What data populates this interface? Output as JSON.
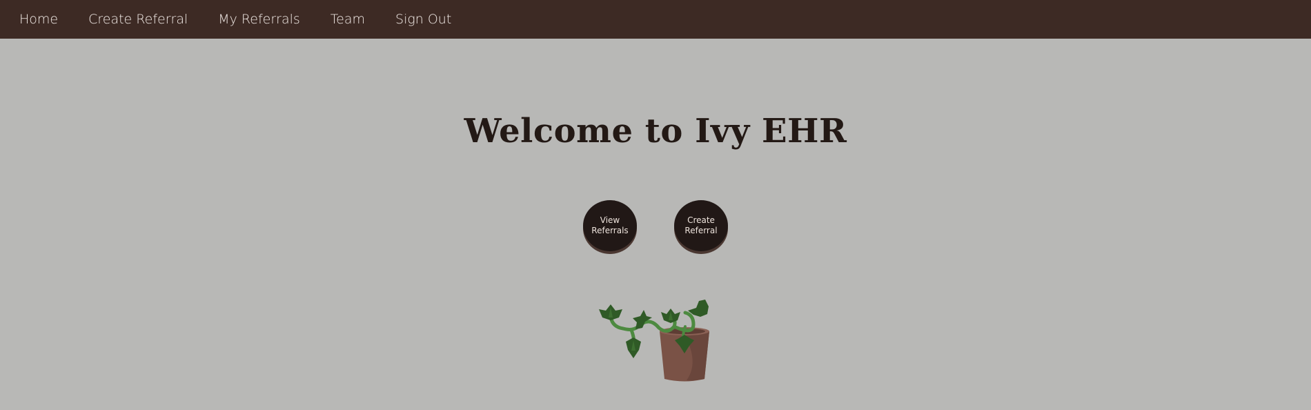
{
  "nav": {
    "items": [
      {
        "label": "Home"
      },
      {
        "label": "Create Referral"
      },
      {
        "label": "My Referrals"
      },
      {
        "label": "Team"
      },
      {
        "label": "Sign Out"
      }
    ]
  },
  "main": {
    "title": "Welcome to Ivy EHR",
    "buttons": {
      "view_referrals": {
        "line1": "View",
        "line2": "Referrals"
      },
      "create_referral": {
        "line1": "Create",
        "line2": "Referral"
      }
    }
  },
  "colors": {
    "nav_background": "#3d2a24",
    "page_background": "#b8b8b6",
    "button_background": "#211816",
    "leaf_green": "#2f5a26",
    "vine_green": "#4d8a40",
    "pot_brown": "#7a5246"
  },
  "illustration": {
    "icon": "ivy-plant-pot-icon"
  }
}
